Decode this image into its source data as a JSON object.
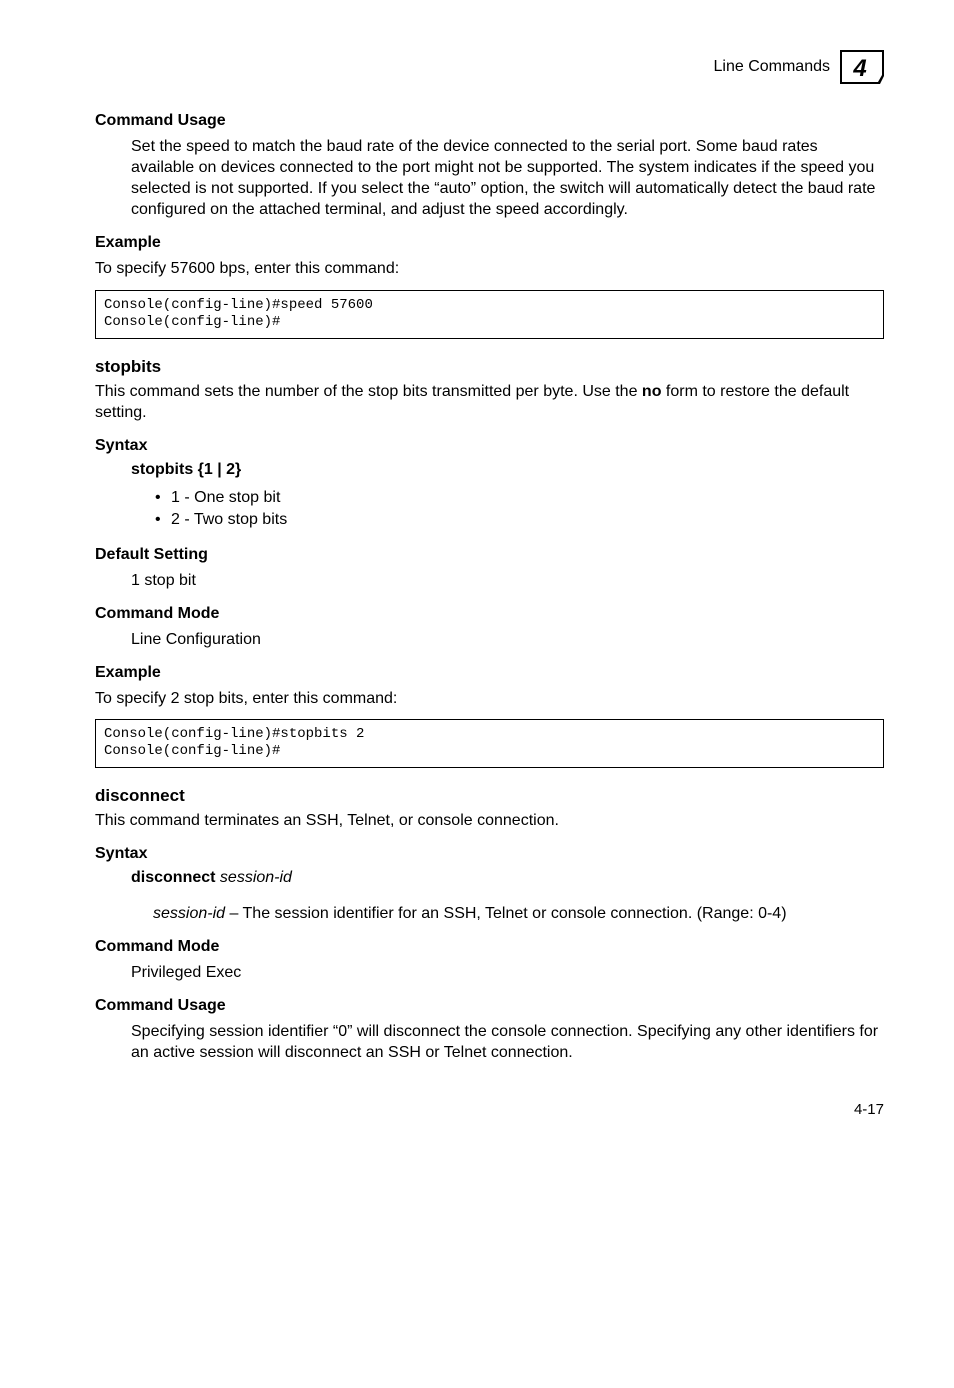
{
  "header": {
    "title": "Line Commands",
    "chapter": "4"
  },
  "sections": {
    "cmd_usage1": {
      "title": "Command Usage",
      "text": "Set the speed to match the baud rate of the device connected to the serial port. Some baud rates available on devices connected to the port might not be supported. The system indicates if the speed you selected is not supported. If you select the “auto” option, the switch will automatically detect the baud rate configured on the attached terminal, and adjust the speed accordingly."
    },
    "example1": {
      "title": "Example",
      "intro": "To specify 57600 bps, enter this command:",
      "code": "Console(config-line)#speed 57600\nConsole(config-line)#"
    },
    "stopbits": {
      "title": "stopbits",
      "desc_pre": "This command sets the number of the stop bits transmitted per byte. Use the ",
      "desc_bold": "no",
      "desc_post": " form to restore the default setting.",
      "syntax_title": "Syntax",
      "syntax_cmd": "stopbits",
      "syntax_args": " {1 | 2}",
      "bullets": [
        "1 - One stop bit",
        "2 - Two stop bits"
      ],
      "default_title": "Default Setting",
      "default_text": "1 stop bit",
      "mode_title": "Command Mode",
      "mode_text": "Line Configuration",
      "example_title": "Example",
      "example_intro": "To specify 2 stop bits, enter this command:",
      "example_code": "Console(config-line)#stopbits 2\nConsole(config-line)#"
    },
    "disconnect": {
      "title": "disconnect",
      "desc": "This command terminates an SSH, Telnet, or console connection.",
      "syntax_title": "Syntax",
      "syntax_cmd": "disconnect",
      "syntax_arg": " session-id",
      "param_name": "session-id",
      "param_desc": " – The session identifier for an SSH, Telnet or console connection. (Range: 0-4)",
      "mode_title": "Command Mode",
      "mode_text": "Privileged Exec",
      "usage_title": "Command Usage",
      "usage_text": "Specifying session identifier “0” will disconnect the console connection. Specifying any other identifiers for an active session will disconnect an SSH or Telnet connection."
    }
  },
  "page_number": "4-17"
}
